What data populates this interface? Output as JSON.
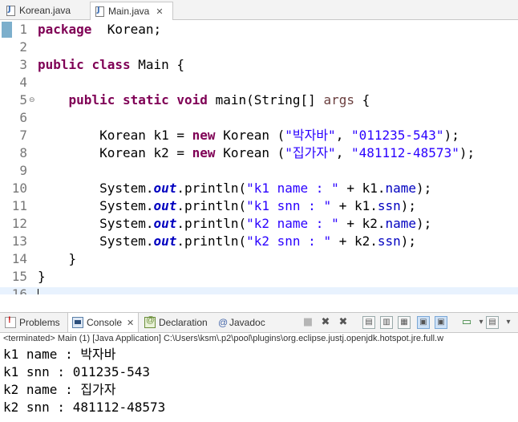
{
  "editor_tabs": [
    {
      "label": "Korean.java",
      "active": false
    },
    {
      "label": "Main.java",
      "active": true,
      "close": "✕"
    }
  ],
  "code": {
    "lines": [
      {
        "num": "1",
        "parts": [
          [
            "kw",
            "package"
          ],
          [
            "",
            "  Korean;"
          ]
        ]
      },
      {
        "num": "2",
        "parts": []
      },
      {
        "num": "3",
        "parts": [
          [
            "kw",
            "public"
          ],
          [
            "",
            " "
          ],
          [
            "kw",
            "class"
          ],
          [
            "",
            " Main {"
          ]
        ]
      },
      {
        "num": "4",
        "parts": []
      },
      {
        "num": "5",
        "fold": "⊖",
        "parts": [
          [
            "",
            "    "
          ],
          [
            "kw",
            "public"
          ],
          [
            "",
            " "
          ],
          [
            "kw",
            "static"
          ],
          [
            "",
            " "
          ],
          [
            "kw",
            "void"
          ],
          [
            "",
            " main(String[] "
          ],
          [
            "var",
            "args"
          ],
          [
            "",
            " {"
          ]
        ]
      },
      {
        "num": "6",
        "parts": []
      },
      {
        "num": "7",
        "parts": [
          [
            "",
            "        Korean k1 = "
          ],
          [
            "kw",
            "new"
          ],
          [
            "",
            " Korean ("
          ],
          [
            "str",
            "\"박자바\""
          ],
          [
            ", ",
            ""
          ],
          [
            "str",
            "\"011235-543\""
          ],
          [
            "",
            ");"
          ]
        ]
      },
      {
        "num": "8",
        "parts": [
          [
            "",
            "        Korean k2 = "
          ],
          [
            "kw",
            "new"
          ],
          [
            "",
            " Korean ("
          ],
          [
            "str",
            "\"집가자\""
          ],
          [
            "",
            ", "
          ],
          [
            "str",
            "\"481112-48573\""
          ],
          [
            "",
            ");"
          ]
        ]
      },
      {
        "num": "9",
        "parts": []
      },
      {
        "num": "10",
        "parts": [
          [
            "",
            "        System."
          ],
          [
            "sfld",
            "out"
          ],
          [
            "",
            ".println("
          ],
          [
            "str",
            "\"k1 name : \""
          ],
          [
            "",
            " + k1."
          ],
          [
            "fld",
            "name"
          ],
          [
            "",
            ");"
          ]
        ]
      },
      {
        "num": "11",
        "parts": [
          [
            "",
            "        System."
          ],
          [
            "sfld",
            "out"
          ],
          [
            "",
            ".println("
          ],
          [
            "str",
            "\"k1 snn : \""
          ],
          [
            "",
            " + k1."
          ],
          [
            "fld",
            "ssn"
          ],
          [
            "",
            ");"
          ]
        ]
      },
      {
        "num": "12",
        "parts": [
          [
            "",
            "        System."
          ],
          [
            "sfld",
            "out"
          ],
          [
            "",
            ".println("
          ],
          [
            "str",
            "\"k2 name : \""
          ],
          [
            "",
            " + k2."
          ],
          [
            "fld",
            "name"
          ],
          [
            "",
            ");"
          ]
        ]
      },
      {
        "num": "13",
        "parts": [
          [
            "",
            "        System."
          ],
          [
            "sfld",
            "out"
          ],
          [
            "",
            ".println("
          ],
          [
            "str",
            "\"k2 snn : \""
          ],
          [
            "",
            " + k2."
          ],
          [
            "fld",
            "ssn"
          ],
          [
            "",
            ");"
          ]
        ]
      },
      {
        "num": "14",
        "parts": [
          [
            "",
            "    }"
          ]
        ]
      },
      {
        "num": "15",
        "parts": [
          [
            "",
            "}"
          ]
        ]
      },
      {
        "num": "16",
        "parts": []
      }
    ]
  },
  "view_tabs": {
    "problems": "Problems",
    "console": "Console",
    "console_close": "✕",
    "declaration": "Declaration",
    "javadoc_icon": "@",
    "javadoc": "Javadoc"
  },
  "toolbar": {
    "terminate_icon": "■",
    "remove_icon": "✖",
    "remove_all_icon": "✖",
    "scroll_lock_icon": "▤",
    "word_wrap_icon": "▥",
    "pin_icon": "▦",
    "show_out_icon": "▣",
    "show_err_icon": "▣",
    "open_console_icon": "▭",
    "display_console_icon": "▾",
    "menu_icon": "▾"
  },
  "console": {
    "status": "<terminated> Main (1) [Java Application] C:\\Users\\ksm\\.p2\\pool\\plugins\\org.eclipse.justj.openjdk.hotspot.jre.full.w",
    "output": [
      "k1 name : 박자바",
      "k1 snn : 011235-543",
      "k2 name : 집가자",
      "k2 snn : 481112-48573"
    ]
  },
  "colors": {
    "keyword": "#7f0055",
    "string": "#2a00ff",
    "field": "#0000c0",
    "current_line": "#e8f2fe"
  }
}
